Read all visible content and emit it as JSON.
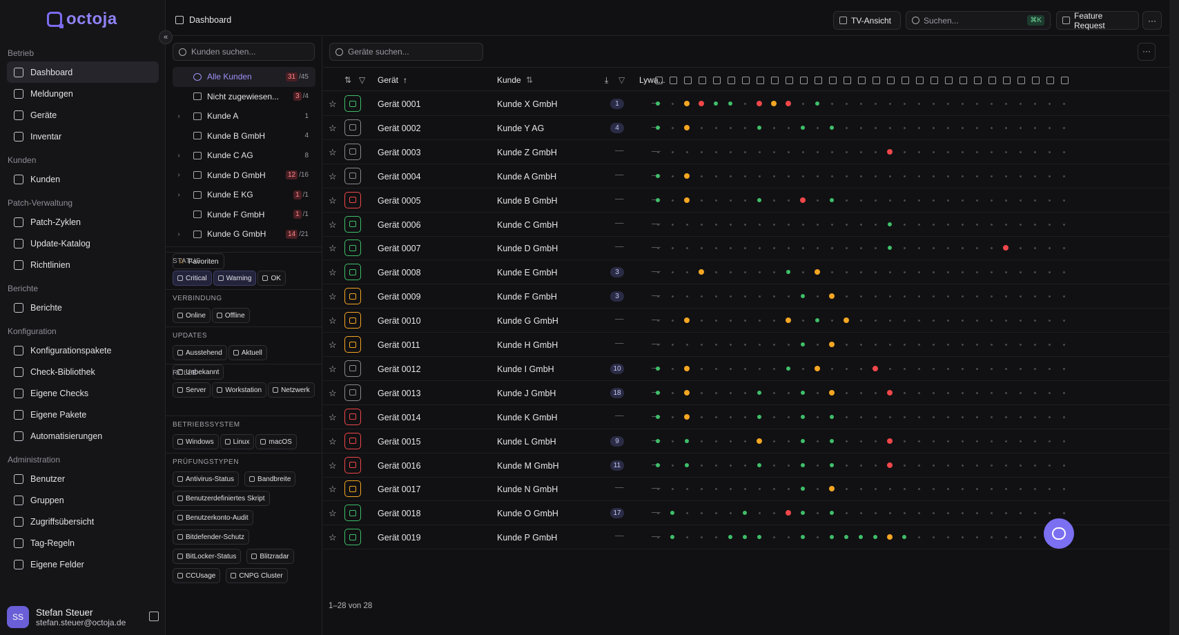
{
  "app": {
    "logo_text": "octoja",
    "brand_color": "#7c6cf0"
  },
  "sidebar": {
    "sections": [
      {
        "title": "Betrieb",
        "items": [
          {
            "label": "Dashboard",
            "icon": "grid-icon",
            "active": true
          },
          {
            "label": "Meldungen",
            "icon": "bell-list-icon"
          },
          {
            "label": "Geräte",
            "icon": "monitor-icon"
          },
          {
            "label": "Inventar",
            "icon": "boxes-icon"
          }
        ]
      },
      {
        "title": "Kunden",
        "items": [
          {
            "label": "Kunden",
            "icon": "building-icon"
          }
        ]
      },
      {
        "title": "Patch-Verwaltung",
        "items": [
          {
            "label": "Patch-Zyklen",
            "icon": "shield-icon"
          },
          {
            "label": "Update-Katalog",
            "icon": "book-icon"
          },
          {
            "label": "Richtlinien",
            "icon": "clipboard-icon"
          }
        ]
      },
      {
        "title": "Berichte",
        "items": [
          {
            "label": "Berichte",
            "icon": "report-icon"
          }
        ]
      },
      {
        "title": "Konfiguration",
        "items": [
          {
            "label": "Konfigurationspakete",
            "icon": "package-icon"
          },
          {
            "label": "Check-Bibliothek",
            "icon": "library-icon"
          },
          {
            "label": "Eigene Checks",
            "icon": "wrench-icon"
          },
          {
            "label": "Eigene Pakete",
            "icon": "package-icon"
          },
          {
            "label": "Automatisierungen",
            "icon": "workflow-icon"
          }
        ]
      },
      {
        "title": "Administration",
        "items": [
          {
            "label": "Benutzer",
            "icon": "user-icon"
          },
          {
            "label": "Gruppen",
            "icon": "users-icon"
          },
          {
            "label": "Zugriffsübersicht",
            "icon": "shield-icon"
          },
          {
            "label": "Tag-Regeln",
            "icon": "tag-icon"
          },
          {
            "label": "Eigene Felder",
            "icon": "list-icon"
          }
        ]
      }
    ],
    "user": {
      "initials": "SS",
      "name": "Stefan Steuer",
      "email": "stefan.steuer@octoja.de"
    }
  },
  "topbar": {
    "breadcrumb": "Dashboard",
    "tv_label": "TV-Ansicht",
    "search_placeholder": "Suchen...",
    "search_shortcut": "⌘K",
    "feature_label": "Feature Request",
    "more_label": "···"
  },
  "filters": {
    "customer_search_placeholder": "Kunden suchen...",
    "customers": [
      {
        "name": "Alle Kunden",
        "critical": "31",
        "total": "/45",
        "active": true,
        "expand": false
      },
      {
        "name": "Nicht zugewiesen...",
        "critical": "3",
        "total": "/4",
        "expand": false
      },
      {
        "name": "Kunde A",
        "critical": "",
        "total": "1",
        "expand": true
      },
      {
        "name": "Kunde B GmbH",
        "critical": "",
        "total": "4",
        "expand": false
      },
      {
        "name": "Kunde C AG",
        "critical": "",
        "total": "8",
        "expand": true
      },
      {
        "name": "Kunde D GmbH",
        "critical": "12",
        "total": "/16",
        "expand": true
      },
      {
        "name": "Kunde E KG",
        "critical": "1",
        "total": "/1",
        "expand": true
      },
      {
        "name": "Kunde F GmbH",
        "critical": "1",
        "total": "/1",
        "expand": false
      },
      {
        "name": "Kunde G GmbH",
        "critical": "14",
        "total": "/21",
        "expand": true
      }
    ],
    "favorites_label": "Favoriten",
    "groups": [
      {
        "title": "STATUS",
        "chips": [
          {
            "label": "Critical",
            "sel": true
          },
          {
            "label": "Warning",
            "sel": true
          },
          {
            "label": "OK"
          }
        ]
      },
      {
        "title": "VERBINDUNG",
        "chips": [
          {
            "label": "Online"
          },
          {
            "label": "Offline"
          }
        ]
      },
      {
        "title": "UPDATES",
        "chips": [
          {
            "label": "Ausstehend"
          },
          {
            "label": "Aktuell"
          },
          {
            "label": "Unbekannt"
          }
        ]
      },
      {
        "title": "ROLLE",
        "chips": [
          {
            "label": "Server"
          },
          {
            "label": "Workstation"
          },
          {
            "label": "Netzwerk"
          }
        ]
      },
      {
        "title": "BETRIEBSSYSTEM",
        "chips": [
          {
            "label": "Windows"
          },
          {
            "label": "Linux"
          },
          {
            "label": "macOS"
          }
        ]
      },
      {
        "title": "PRÜFUNGSTYPEN",
        "chips": [
          {
            "label": "Antivirus-Status"
          },
          {
            "label": "Bandbreite"
          },
          {
            "label": "Benutzerdefiniertes Skript"
          },
          {
            "label": "Benutzerkonto-Audit"
          },
          {
            "label": "Bitdefender-Schutz"
          },
          {
            "label": "BitLocker-Status"
          },
          {
            "label": "Blitzradar"
          },
          {
            "label": "CCUsage"
          },
          {
            "label": "CNPG Cluster"
          }
        ]
      }
    ]
  },
  "table": {
    "search_placeholder": "Geräte suchen...",
    "col_device": "Gerät",
    "col_customer": "Kunde",
    "col_lywa": "Lywa...",
    "pagination": "1–28 von 28",
    "status_colors": {
      "ok": "#3fbf6a",
      "warning": "#f5a623",
      "critical": "#f0474a"
    },
    "rows": [
      {
        "device": "Gerät 0001",
        "customer": "Kunde X GmbH",
        "badge": "1",
        "icon_color": "#3fbf6a",
        "dots": "g.-o.r.g.g.-r.o.r.-g.------------"
      },
      {
        "device": "Gerät 0002",
        "customer": "Kunde Y AG",
        "badge": "4",
        "icon_color": "#8a8a90",
        "dots": "g.-o.----g.--g.-g.------------"
      },
      {
        "device": "Gerät 0003",
        "customer": "Kunde Z GmbH",
        "badge": "",
        "icon_color": "#8a8a90",
        "dots": "----------------r.-----------"
      },
      {
        "device": "Gerät 0004",
        "customer": "Kunde A GmbH",
        "badge": "",
        "icon_color": "#8a8a90",
        "dots": "g.-o.-------------------------"
      },
      {
        "device": "Gerät 0005",
        "customer": "Kunde B GmbH",
        "badge": "",
        "icon_color": "#f0474a",
        "dots": "g.-o.----g.--r.-g.------------"
      },
      {
        "device": "Gerät 0006",
        "customer": "Kunde C GmbH",
        "badge": "",
        "icon_color": "#3fbf6a",
        "dots": "----------------g.------------"
      },
      {
        "device": "Gerät 0007",
        "customer": "Kunde D GmbH",
        "badge": "",
        "icon_color": "#3fbf6a",
        "dots": "----------------g.-------r.-----"
      },
      {
        "device": "Gerät 0008",
        "customer": "Kunde E GmbH",
        "badge": "3",
        "icon_color": "#3fbf6a",
        "dots": "---o.-----g.-o.-------------"
      },
      {
        "device": "Gerät 0009",
        "customer": "Kunde F GmbH",
        "badge": "3",
        "icon_color": "#f5a623",
        "dots": "----------g.-o.-------------"
      },
      {
        "device": "Gerät 0010",
        "customer": "Kunde G GmbH",
        "badge": "",
        "icon_color": "#f5a623",
        "dots": "--o.------o.-g.-o.-------------"
      },
      {
        "device": "Gerät 0011",
        "customer": "Kunde H GmbH",
        "badge": "",
        "icon_color": "#f5a623",
        "dots": "----------g.-o.-------------"
      },
      {
        "device": "Gerät 0012",
        "customer": "Kunde I GmbH",
        "badge": "10",
        "icon_color": "#8a8a90",
        "dots": "g.-o.------g.-o.---r.--------"
      },
      {
        "device": "Gerät 0013",
        "customer": "Kunde J GmbH",
        "badge": "18",
        "icon_color": "#8a8a90",
        "dots": "g.-o.----g.--g.-o.---r.--------"
      },
      {
        "device": "Gerät 0014",
        "customer": "Kunde K GmbH",
        "badge": "",
        "icon_color": "#f0474a",
        "dots": "g.-o.----g.--g.-g.------------"
      },
      {
        "device": "Gerät 0015",
        "customer": "Kunde L GmbH",
        "badge": "9",
        "icon_color": "#f0474a",
        "dots": "g.-g.----o.--g.-g.---r.--------"
      },
      {
        "device": "Gerät 0016",
        "customer": "Kunde M GmbH",
        "badge": "11",
        "icon_color": "#f0474a",
        "dots": "g.-g.----g.--g.-g.---r.--------"
      },
      {
        "device": "Gerät 0017",
        "customer": "Kunde N GmbH",
        "badge": "",
        "icon_color": "#f5a623",
        "dots": "----------g.-o.-------------"
      },
      {
        "device": "Gerät 0018",
        "customer": "Kunde O GmbH",
        "badge": "17",
        "icon_color": "#3fbf6a",
        "dots": "-g.----g.--r.g.-g.------------"
      },
      {
        "device": "Gerät 0019",
        "customer": "Kunde P GmbH",
        "badge": "",
        "icon_color": "#3fbf6a",
        "dots": "-g.---g.g.g.--g.-g.g.g.g.o.g.----------"
      }
    ]
  }
}
